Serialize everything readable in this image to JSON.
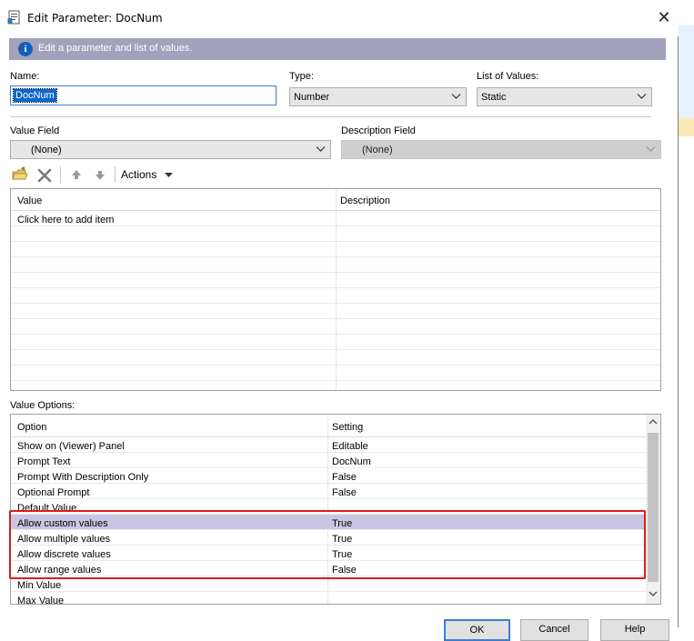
{
  "dialog": {
    "title": "Edit Parameter: DocNum",
    "banner_text": "Edit a parameter and list of values."
  },
  "form": {
    "name_label": "Name:",
    "name_value": "DocNum",
    "type_label": "Type:",
    "type_value": "Number",
    "lov_label": "List of Values:",
    "lov_value": "Static",
    "value_field_label": "Value Field",
    "value_field_value": "(None)",
    "desc_field_label": "Description Field",
    "desc_field_value": "(None)"
  },
  "toolbar": {
    "actions_label": "Actions"
  },
  "values_grid": {
    "headers": [
      "Value",
      "Description"
    ],
    "placeholder_row": "Click here to add item"
  },
  "value_options": {
    "label": "Value Options:",
    "headers": [
      "Option",
      "Setting"
    ],
    "rows": [
      {
        "option": "Show on (Viewer) Panel",
        "setting": "Editable"
      },
      {
        "option": "Prompt Text",
        "setting": "DocNum"
      },
      {
        "option": "Prompt With Description Only",
        "setting": "False"
      },
      {
        "option": "Optional Prompt",
        "setting": "False"
      },
      {
        "option": "Default Value",
        "setting": ""
      },
      {
        "option": "Allow custom values",
        "setting": "True"
      },
      {
        "option": "Allow multiple values",
        "setting": "True"
      },
      {
        "option": "Allow discrete values",
        "setting": "True"
      },
      {
        "option": "Allow range values",
        "setting": "False"
      },
      {
        "option": "Min Value",
        "setting": ""
      },
      {
        "option": "Max Value",
        "setting": ""
      }
    ],
    "selected_index": 5
  },
  "footer": {
    "ok_label": "OK",
    "cancel_label": "Cancel",
    "help_label": "Help"
  },
  "colors": {
    "banner": "#a3a2bc",
    "selection_row": "#c9c5e3",
    "highlight_border": "#e01b1b"
  }
}
